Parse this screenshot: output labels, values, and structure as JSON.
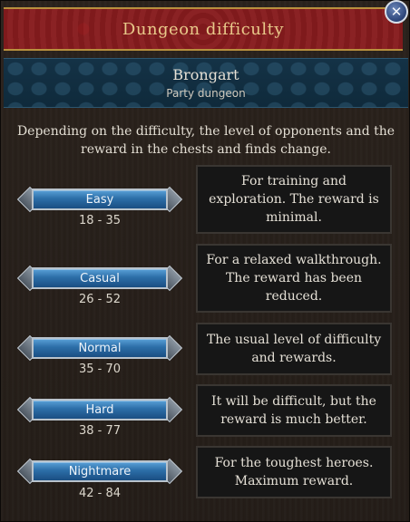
{
  "window": {
    "title": "Dungeon difficulty",
    "close_label": "✕"
  },
  "dungeon": {
    "name": "Brongart",
    "subtitle": "Party dungeon"
  },
  "intro_text": "Depending on the difficulty, the level of opponents and the reward in the chests and finds change.",
  "difficulties": [
    {
      "label": "Easy",
      "levels": "18 - 35",
      "description": "For training and exploration. The reward is minimal."
    },
    {
      "label": "Casual",
      "levels": "26 - 52",
      "description": "For a relaxed walkthrough. The reward has been reduced."
    },
    {
      "label": "Normal",
      "levels": "35 - 70",
      "description": "The usual level of difficulty and rewards."
    },
    {
      "label": "Hard",
      "levels": "38 - 77",
      "description": "It will be difficult, but the reward is much better."
    },
    {
      "label": "Nightmare",
      "levels": "42 - 84",
      "description": "For the toughest heroes. Maximum reward."
    }
  ],
  "colors": {
    "title_bar": "#7f1a1c",
    "header_band": "#143246",
    "button_blue": "#2c6ea8",
    "title_text": "#e8c98a"
  }
}
